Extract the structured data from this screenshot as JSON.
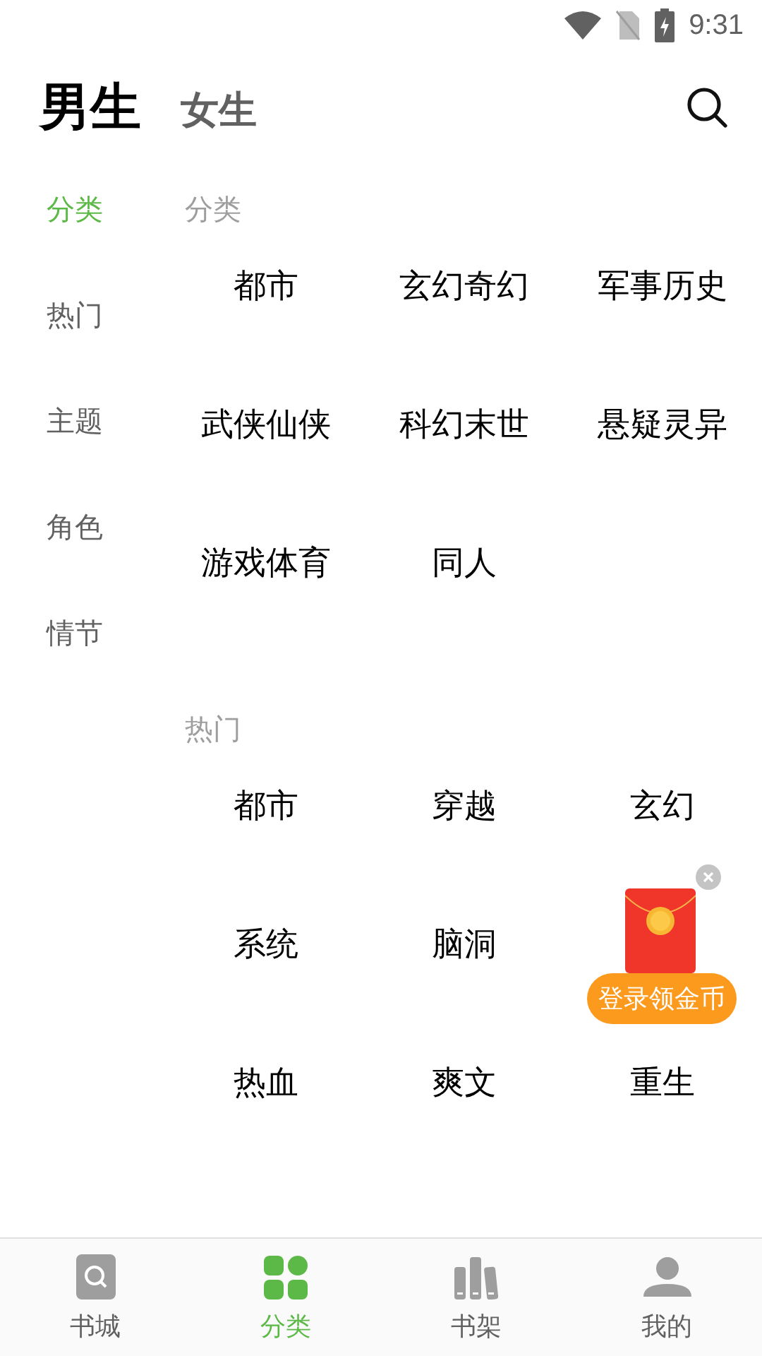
{
  "status_bar": {
    "time": "9:31"
  },
  "gender_tabs": [
    {
      "label": "男生",
      "selected": true
    },
    {
      "label": "女生",
      "selected": false
    }
  ],
  "side_nav": [
    {
      "label": "分类",
      "selected": true
    },
    {
      "label": "热门",
      "selected": false
    },
    {
      "label": "主题",
      "selected": false
    },
    {
      "label": "角色",
      "selected": false
    },
    {
      "label": "情节",
      "selected": false
    }
  ],
  "sections": [
    {
      "title": "分类",
      "rows": [
        [
          "都市",
          "玄幻奇幻",
          "军事历史"
        ],
        [
          "武侠仙侠",
          "科幻末世",
          "悬疑灵异"
        ],
        [
          "游戏体育",
          "同人"
        ]
      ]
    },
    {
      "title": "热门",
      "rows": [
        [
          "都市",
          "穿越",
          "玄幻"
        ],
        [
          "系统",
          "脑洞"
        ],
        [
          "热血",
          "爽文",
          "重生"
        ]
      ]
    }
  ],
  "promo": {
    "label": "登录领金币"
  },
  "bottom_nav": [
    {
      "label": "书城",
      "kind": "store",
      "selected": false
    },
    {
      "label": "分类",
      "kind": "category",
      "selected": true
    },
    {
      "label": "书架",
      "kind": "shelf",
      "selected": false
    },
    {
      "label": "我的",
      "kind": "profile",
      "selected": false
    }
  ]
}
